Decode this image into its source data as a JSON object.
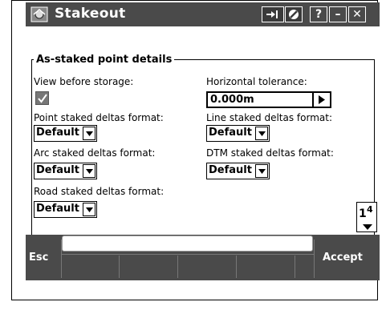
{
  "window": {
    "title": "Stakeout",
    "icons": [
      "stakeout-app-icon",
      "transfer-icon",
      "no-entry-icon"
    ],
    "buttons": {
      "help": "?",
      "minimize": "–",
      "close": "✕"
    }
  },
  "section": {
    "title": "As-staked point details"
  },
  "fields": {
    "view_before_storage": {
      "label": "View before storage:",
      "checked": true
    },
    "horizontal_tolerance": {
      "label": "Horizontal tolerance:",
      "value": "0.000m"
    },
    "point_deltas": {
      "label": "Point staked deltas format:",
      "value": "Default"
    },
    "line_deltas": {
      "label": "Line staked deltas format:",
      "value": "Default"
    },
    "arc_deltas": {
      "label": "Arc staked deltas format:",
      "value": "Default"
    },
    "dtm_deltas": {
      "label": "DTM staked deltas format:",
      "value": "Default"
    },
    "road_deltas": {
      "label": "Road staked deltas format:",
      "value": "Default"
    }
  },
  "page_indicator": {
    "current": "1",
    "total": "4"
  },
  "softkeys": {
    "left": "Esc",
    "right": "Accept",
    "input_value": ""
  }
}
